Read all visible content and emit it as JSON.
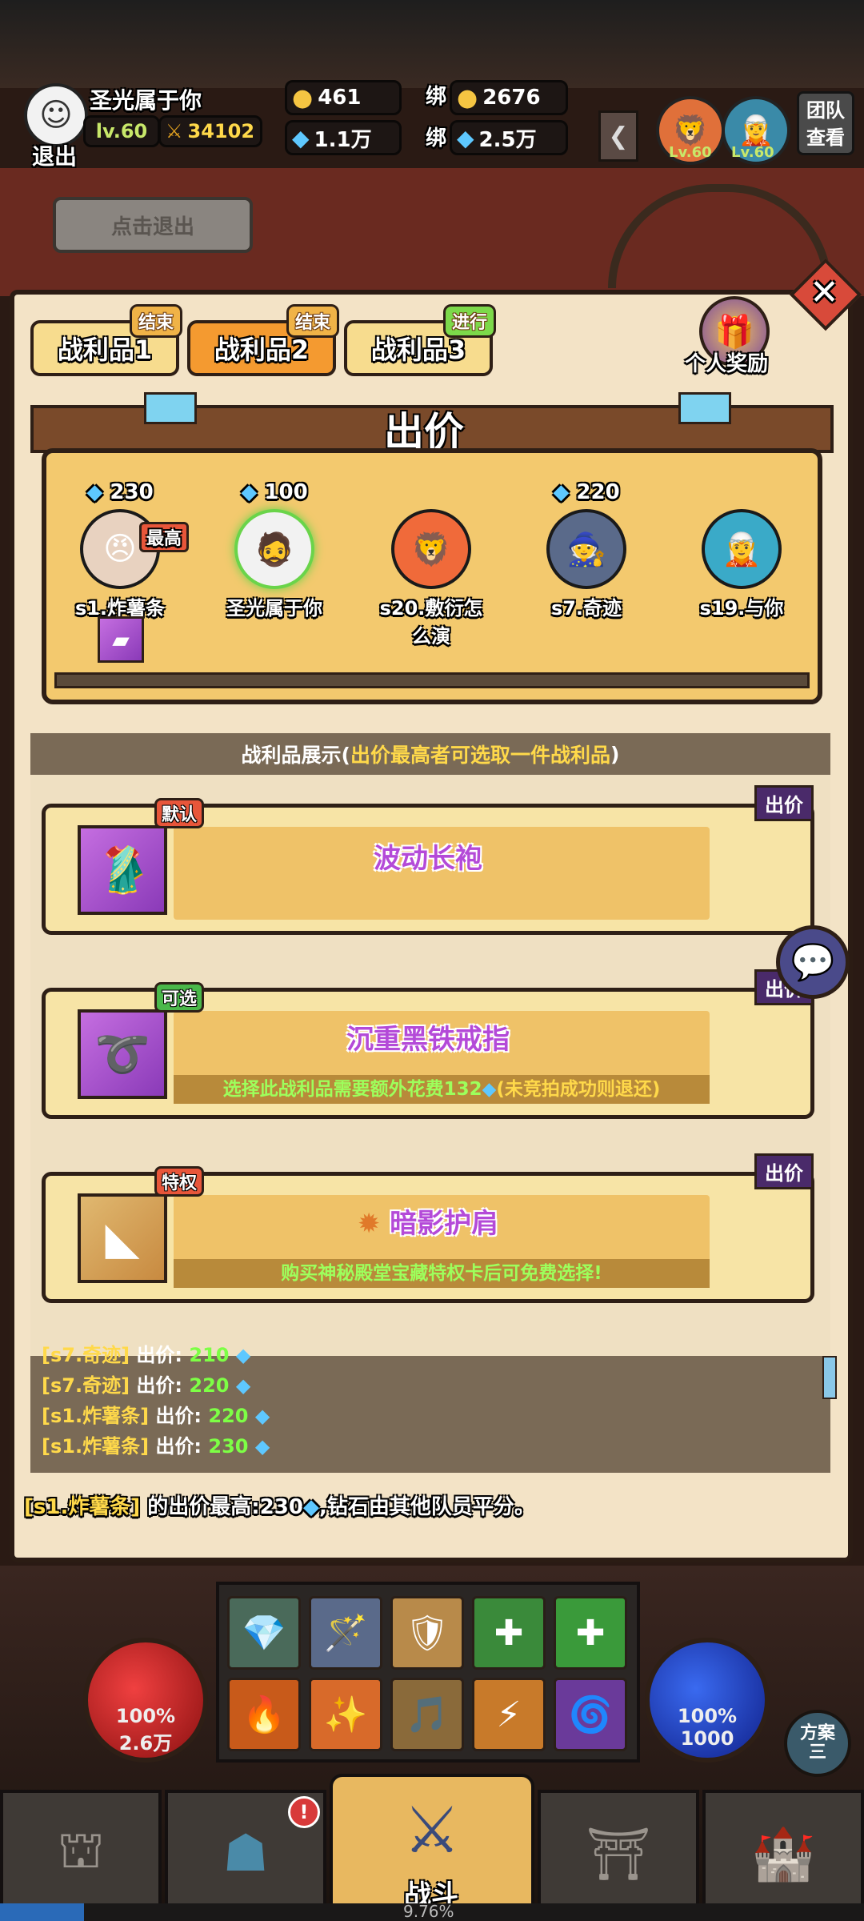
{
  "player": {
    "name": "圣光属于你",
    "level": "lv.60",
    "power": "34102",
    "exit_label": "退出"
  },
  "currency": {
    "gold": "461",
    "diamond": "1.1万",
    "bound_label": "绑",
    "bound_gold": "2676",
    "bound_diamond": "2.5万"
  },
  "team": {
    "member1_level": "Lv.60",
    "member2_level": "Lv.60",
    "team_view_label": "团队\n查看"
  },
  "click_exit_label": "点击退出",
  "tabs": [
    {
      "label": "战利品1",
      "badge": "结束"
    },
    {
      "label": "战利品2",
      "badge": "结束"
    },
    {
      "label": "战利品3",
      "badge": "进行"
    }
  ],
  "personal_reward_label": "个人奖励",
  "bid_header": "出价",
  "bidders": [
    {
      "name": "s1.炸薯条",
      "bid": "230",
      "badge": "最高",
      "icon": "angry-face"
    },
    {
      "name": "圣光属于你",
      "bid": "100",
      "badge": "",
      "icon": "turban-face"
    },
    {
      "name": "s20.敷衍怎么演",
      "bid": "",
      "badge": "",
      "icon": "lion-dance-face"
    },
    {
      "name": "s7.奇迹",
      "bid": "220",
      "badge": "",
      "icon": "knight-face"
    },
    {
      "name": "s19.与你",
      "bid": "",
      "badge": "",
      "icon": "elf-face"
    }
  ],
  "loot_display_title": {
    "prefix": "战利品展示(",
    "highlight": "出价最高者可选取一件战利品",
    "suffix": ")"
  },
  "loot_items": [
    {
      "tag": "默认",
      "name": "波动长袍",
      "note": "",
      "bid_label": "出价",
      "icon": "robe-icon"
    },
    {
      "tag": "可选",
      "name": "沉重黑铁戒指",
      "note": "选择此战利品需要额外花费132",
      "note_suffix": "(未竞拍成功则退还)",
      "bid_label": "出价",
      "icon": "ring-icon"
    },
    {
      "tag": "特权",
      "name": "暗影护肩",
      "note": "购买神秘殿堂宝藏特权卡后可免费选择!",
      "bid_label": "出价",
      "icon": "shoulder-icon"
    }
  ],
  "log": [
    {
      "name": "[s7.奇迹]",
      "text": "出价:",
      "value": "210"
    },
    {
      "name": "[s7.奇迹]",
      "text": "出价:",
      "value": "220"
    },
    {
      "name": "[s1.炸薯条]",
      "text": "出价:",
      "value": "220"
    },
    {
      "name": "[s1.炸薯条]",
      "text": "出价:",
      "value": "230"
    }
  ],
  "summary": {
    "name": "[s1.炸薯条]",
    "text1": "的出价最高:230",
    "text2": ",钻石由其他队员平分。"
  },
  "hp": {
    "percent": "100%",
    "value": "2.6万"
  },
  "mp": {
    "percent": "100%",
    "value": "1000"
  },
  "scheme_label": "方案\n三",
  "battle_label": "战斗",
  "progress_text": "9.76%",
  "progress_value": 0.0976,
  "colors": {
    "accent_gold": "#f3c96e",
    "panel_bg": "#f3e3c6",
    "loot_name": "#b44ad8",
    "note_green": "#7dff45"
  }
}
